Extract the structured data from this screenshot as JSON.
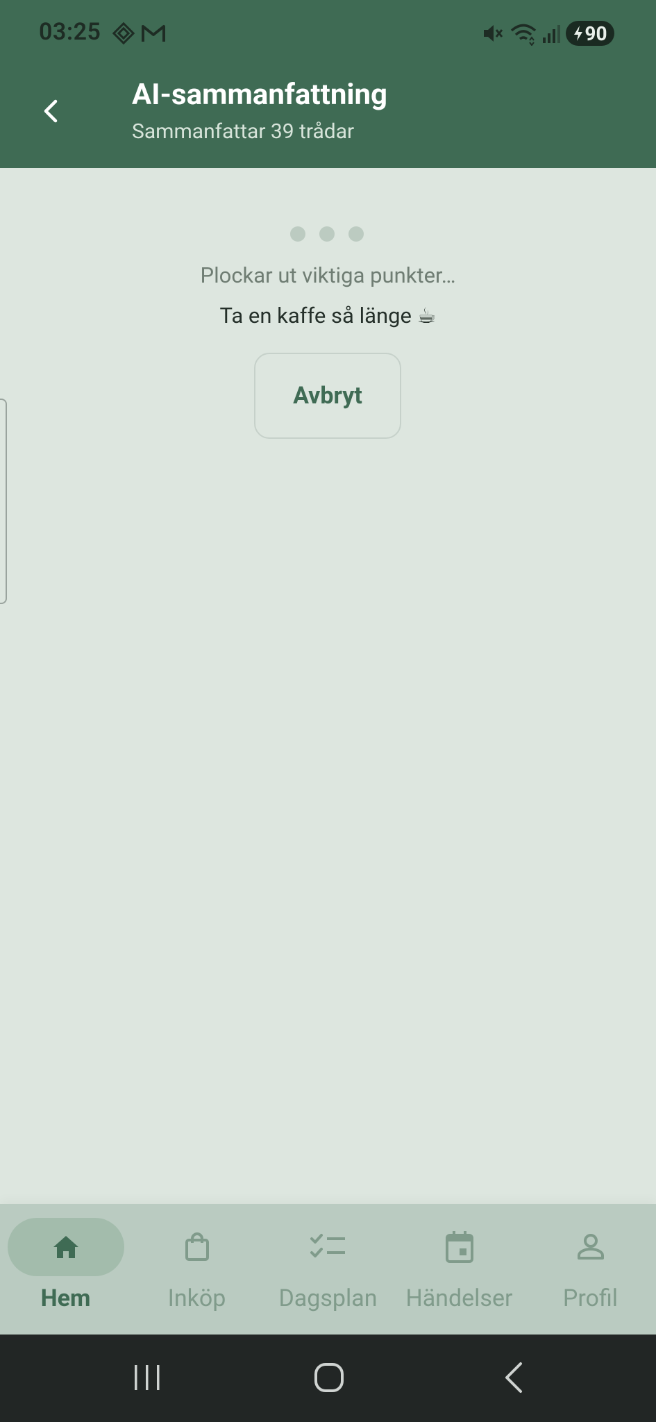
{
  "status_bar": {
    "time": "03:25",
    "battery": "90",
    "icons": [
      "signal-app-icon",
      "gmail-icon",
      "mute-icon",
      "wifi-icon",
      "cell-signal-icon",
      "battery-icon"
    ]
  },
  "app_bar": {
    "title": "AI-sammanfattning",
    "subtitle": "Sammanfattar 39 trådar"
  },
  "loading": {
    "status_text": "Plockar ut viktiga punkter…",
    "hint_text": "Ta en kaffe så länge ☕",
    "cancel_label": "Avbryt"
  },
  "bottom_nav": {
    "items": [
      {
        "label": "Hem",
        "icon": "home-icon",
        "active": true
      },
      {
        "label": "Inköp",
        "icon": "shopping-bag-icon",
        "active": false
      },
      {
        "label": "Dagsplan",
        "icon": "checklist-icon",
        "active": false
      },
      {
        "label": "Händelser",
        "icon": "calendar-icon",
        "active": false
      },
      {
        "label": "Profil",
        "icon": "person-icon",
        "active": false
      }
    ]
  },
  "colors": {
    "primary": "#3f6b54",
    "background": "#dde6df",
    "nav_background": "#bacbc1",
    "nav_active_pill": "#a3bcac",
    "nav_inactive": "#809b8b"
  }
}
